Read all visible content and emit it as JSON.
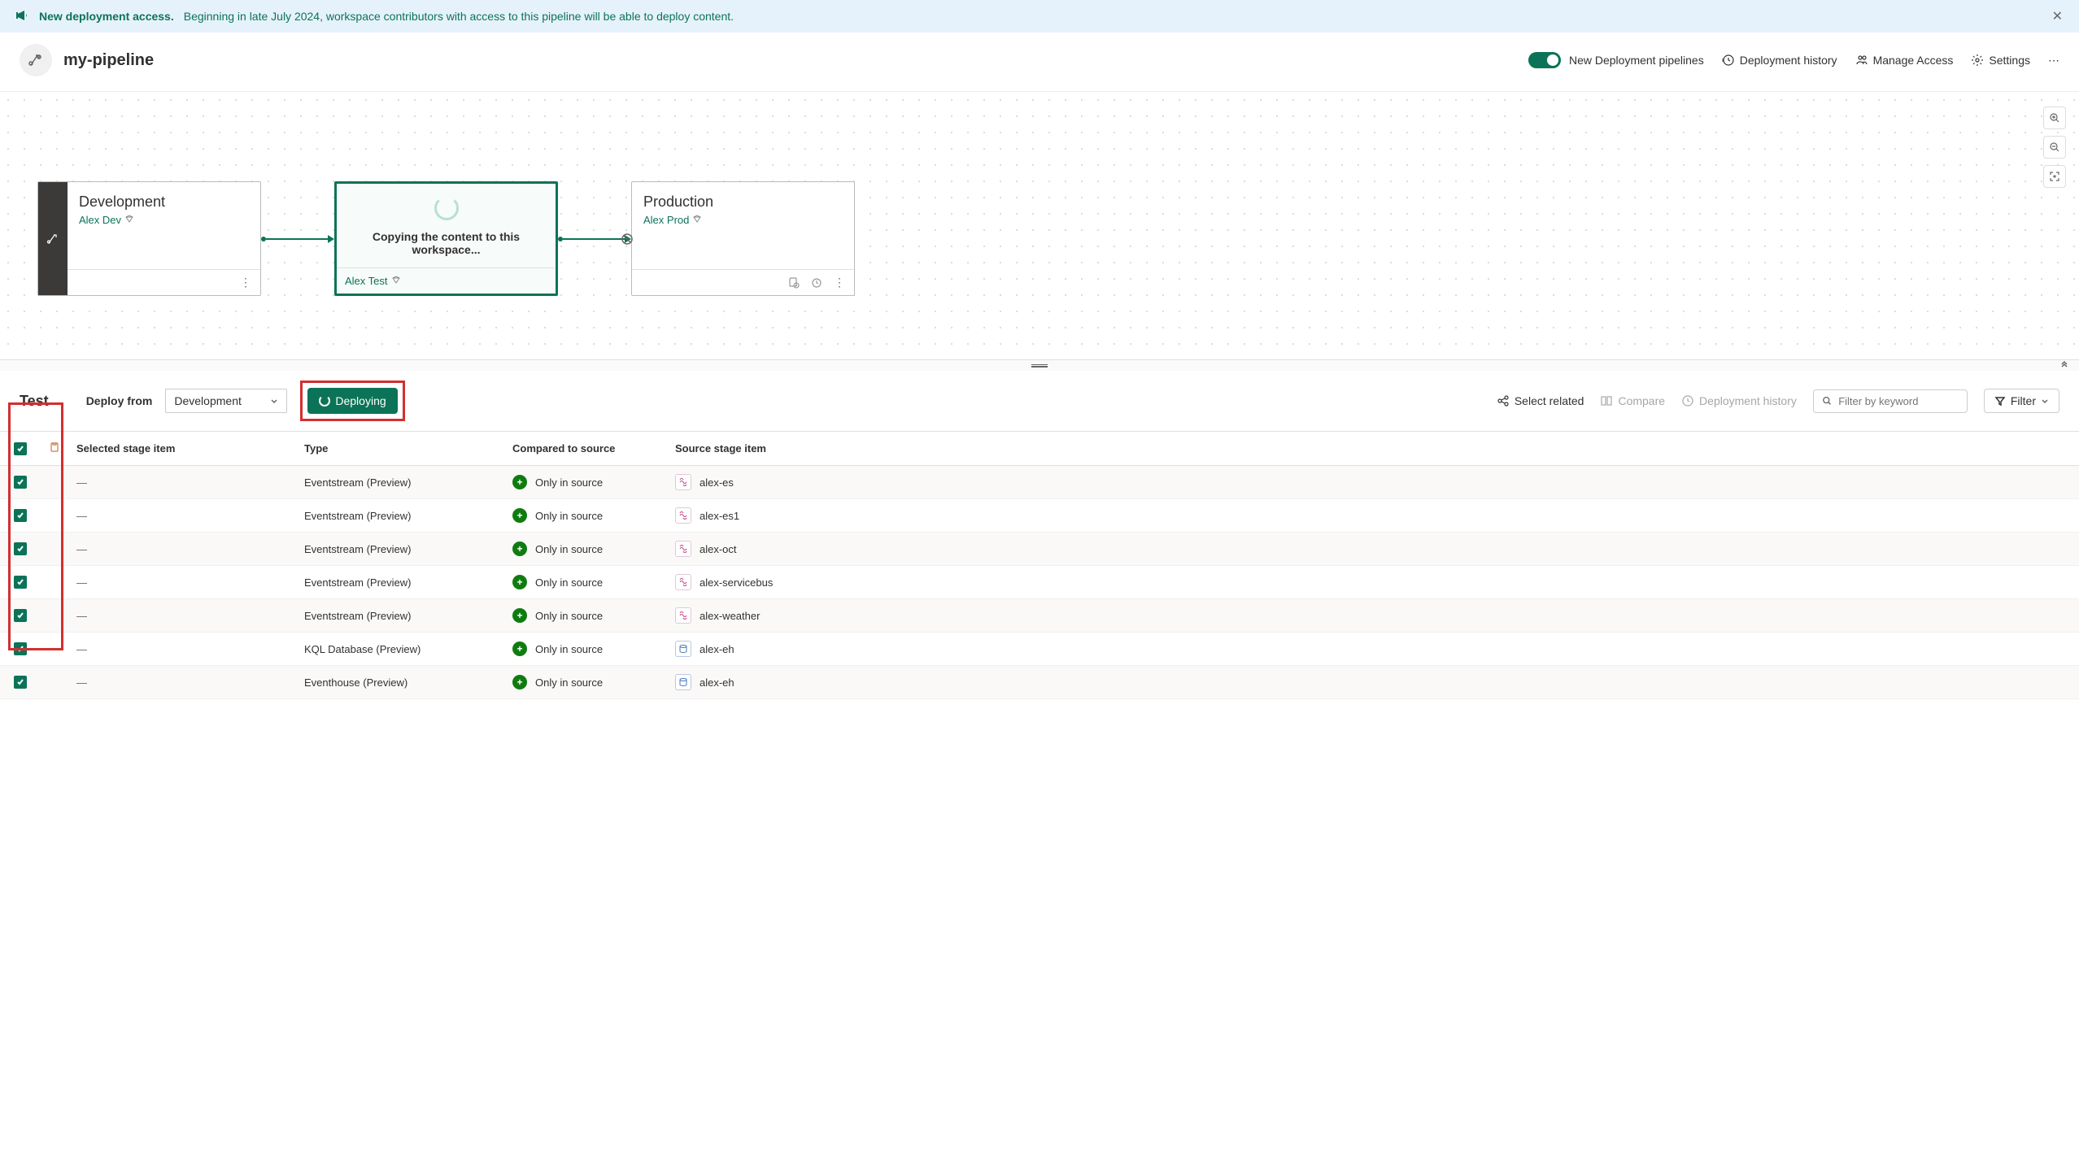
{
  "banner": {
    "title": "New deployment access.",
    "message": "Beginning in late July 2024, workspace contributors with access to this pipeline will be able to deploy content."
  },
  "header": {
    "title": "my-pipeline",
    "toggle_label": "New Deployment pipelines",
    "history": "Deployment history",
    "access": "Manage Access",
    "settings": "Settings"
  },
  "stages": {
    "dev": {
      "name": "Development",
      "workspace": "Alex Dev"
    },
    "test": {
      "copying": "Copying the content to this workspace...",
      "workspace": "Alex Test"
    },
    "prod": {
      "name": "Production",
      "workspace": "Alex Prod"
    }
  },
  "toolbar": {
    "stage": "Test",
    "deploy_from_label": "Deploy from",
    "deploy_from_value": "Development",
    "deploy_btn": "Deploying",
    "select_related": "Select related",
    "compare": "Compare",
    "history": "Deployment history",
    "search_placeholder": "Filter by keyword",
    "filter": "Filter"
  },
  "table": {
    "headers": {
      "selected": "Selected stage item",
      "type": "Type",
      "compared": "Compared to source",
      "source": "Source stage item"
    },
    "only_in_source": "Only in source",
    "rows": [
      {
        "selected": "—",
        "type": "Eventstream (Preview)",
        "source": "alex-es",
        "icon": "es"
      },
      {
        "selected": "—",
        "type": "Eventstream (Preview)",
        "source": "alex-es1",
        "icon": "es"
      },
      {
        "selected": "—",
        "type": "Eventstream (Preview)",
        "source": "alex-oct",
        "icon": "es"
      },
      {
        "selected": "—",
        "type": "Eventstream (Preview)",
        "source": "alex-servicebus",
        "icon": "es"
      },
      {
        "selected": "—",
        "type": "Eventstream (Preview)",
        "source": "alex-weather",
        "icon": "es"
      },
      {
        "selected": "—",
        "type": "KQL Database (Preview)",
        "source": "alex-eh",
        "icon": "db"
      },
      {
        "selected": "—",
        "type": "Eventhouse (Preview)",
        "source": "alex-eh",
        "icon": "db"
      }
    ]
  }
}
